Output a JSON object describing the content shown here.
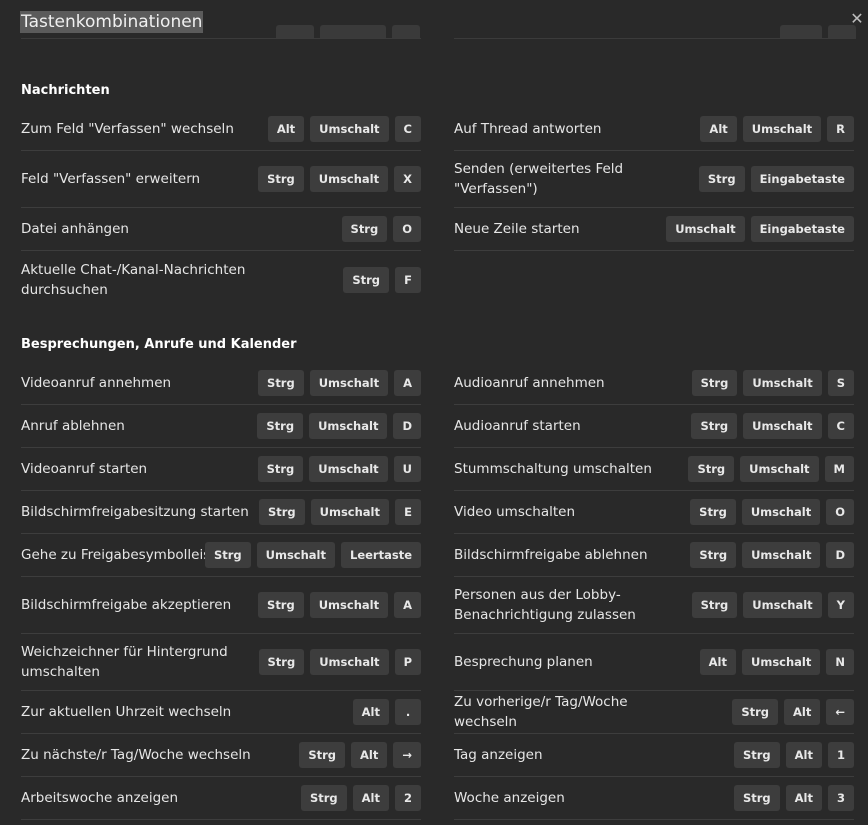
{
  "dialog": {
    "title": "Tastenkombinationen",
    "close_icon": "✕"
  },
  "sections": [
    {
      "title": "Nachrichten",
      "left": [
        {
          "label": "Zum Feld \"Verfassen\" wechseln",
          "keys": [
            "Alt",
            "Umschalt",
            "C"
          ]
        },
        {
          "label": "Feld \"Verfassen\" erweitern",
          "keys": [
            "Strg",
            "Umschalt",
            "X"
          ]
        },
        {
          "label": "Datei anhängen",
          "keys": [
            "Strg",
            "O"
          ]
        },
        {
          "label": "Aktuelle Chat-/Kanal-Nachrichten durchsuchen",
          "keys": [
            "Strg",
            "F"
          ]
        }
      ],
      "right": [
        {
          "label": "Auf Thread antworten",
          "keys": [
            "Alt",
            "Umschalt",
            "R"
          ]
        },
        {
          "label": "Senden (erweitertes Feld \"Verfassen\")",
          "keys": [
            "Strg",
            "Eingabetaste"
          ]
        },
        {
          "label": "Neue Zeile starten",
          "keys": [
            "Umschalt",
            "Eingabetaste"
          ]
        }
      ]
    },
    {
      "title": "Besprechungen, Anrufe und Kalender",
      "left": [
        {
          "label": "Videoanruf annehmen",
          "keys": [
            "Strg",
            "Umschalt",
            "A"
          ]
        },
        {
          "label": "Anruf ablehnen",
          "keys": [
            "Strg",
            "Umschalt",
            "D"
          ]
        },
        {
          "label": "Videoanruf starten",
          "keys": [
            "Strg",
            "Umschalt",
            "U"
          ]
        },
        {
          "label": "Bildschirmfreigabesitzung starten",
          "keys": [
            "Strg",
            "Umschalt",
            "E"
          ]
        },
        {
          "label": "Gehe zu Freigabesymbolleiste",
          "keys": [
            "Strg",
            "Umschalt",
            "Leertaste"
          ]
        },
        {
          "label": "Bildschirmfreigabe akzeptieren",
          "keys": [
            "Strg",
            "Umschalt",
            "A"
          ]
        },
        {
          "label": "Weichzeichner für Hintergrund umschalten",
          "keys": [
            "Strg",
            "Umschalt",
            "P"
          ]
        },
        {
          "label": "Zur aktuellen Uhrzeit wechseln",
          "keys": [
            "Alt",
            "."
          ]
        },
        {
          "label": "Zu nächste/r Tag/Woche wechseln",
          "keys": [
            "Strg",
            "Alt",
            "→"
          ]
        },
        {
          "label": "Arbeitswoche anzeigen",
          "keys": [
            "Strg",
            "Alt",
            "2"
          ]
        }
      ],
      "right": [
        {
          "label": "Audioanruf annehmen",
          "keys": [
            "Strg",
            "Umschalt",
            "S"
          ]
        },
        {
          "label": "Audioanruf starten",
          "keys": [
            "Strg",
            "Umschalt",
            "C"
          ]
        },
        {
          "label": "Stummschaltung umschalten",
          "keys": [
            "Strg",
            "Umschalt",
            "M"
          ]
        },
        {
          "label": "Video umschalten",
          "keys": [
            "Strg",
            "Umschalt",
            "O"
          ]
        },
        {
          "label": "Bildschirmfreigabe ablehnen",
          "keys": [
            "Strg",
            "Umschalt",
            "D"
          ]
        },
        {
          "label": "Personen aus der Lobby-Benachrichtigung zulassen",
          "keys": [
            "Strg",
            "Umschalt",
            "Y"
          ]
        },
        {
          "label": "Besprechung planen",
          "keys": [
            "Alt",
            "Umschalt",
            "N"
          ]
        },
        {
          "label": "Zu vorherige/r Tag/Woche wechseln",
          "keys": [
            "Strg",
            "Alt",
            "←"
          ]
        },
        {
          "label": "Tag anzeigen",
          "keys": [
            "Strg",
            "Alt",
            "1"
          ]
        },
        {
          "label": "Woche anzeigen",
          "keys": [
            "Strg",
            "Alt",
            "3"
          ]
        }
      ]
    }
  ]
}
